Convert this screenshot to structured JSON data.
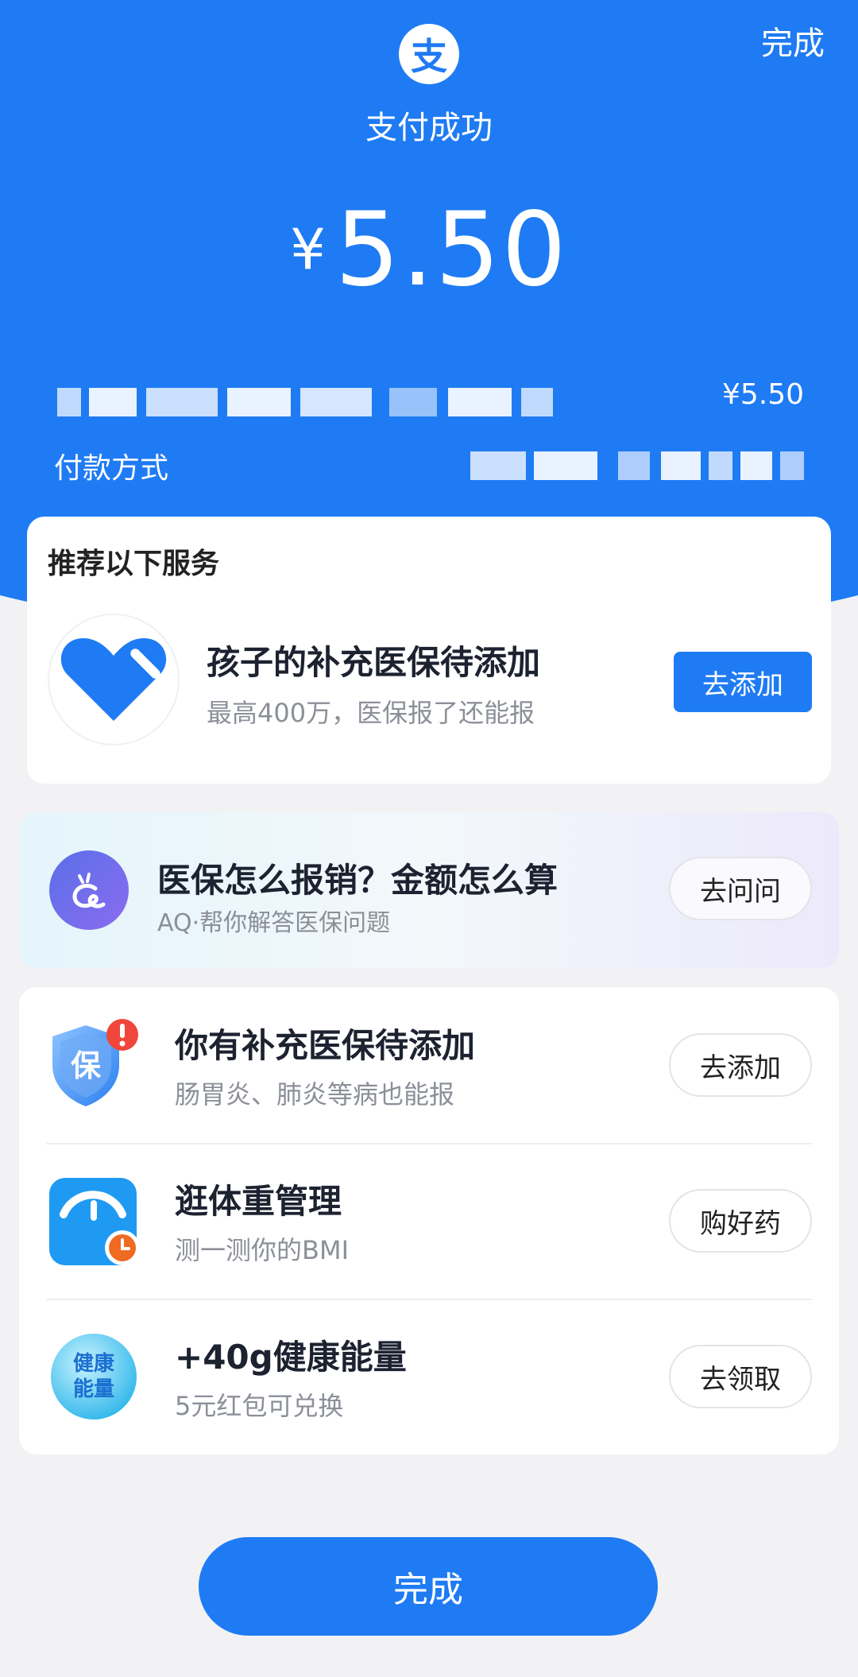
{
  "header": {
    "done_label": "完成",
    "logo_char": "支",
    "title": "支付成功",
    "currency": "¥",
    "amount": "5.50",
    "merchant_amount": "¥5.50",
    "payment_method_label": "付款方式"
  },
  "recommend": {
    "section_title": "推荐以下服务",
    "title": "孩子的补充医保待添加",
    "subtitle": "最高400万，医保报了还能报",
    "button": "去添加",
    "icon": "heart-bandage-icon"
  },
  "aq": {
    "title": "医保怎么报销？金额怎么算",
    "subtitle": "AQ·帮你解答医保问题",
    "button": "去问问",
    "icon": "aq-assistant-icon"
  },
  "services": [
    {
      "title": "你有补充医保待添加",
      "subtitle": "肠胃炎、肺炎等病也能报",
      "button": "去添加",
      "icon": "insurance-shield-icon",
      "icon_text": "保"
    },
    {
      "title": "逛体重管理",
      "subtitle": "测一测你的BMI",
      "button": "购好药",
      "icon": "scale-icon"
    },
    {
      "title": "+40g健康能量",
      "subtitle": "5元红包可兑换",
      "button": "去领取",
      "icon": "health-energy-icon",
      "icon_text": "健康能量"
    }
  ],
  "footer": {
    "done_label": "完成"
  },
  "colors": {
    "primary": "#1f7bf3",
    "background": "#f2f2f4"
  }
}
